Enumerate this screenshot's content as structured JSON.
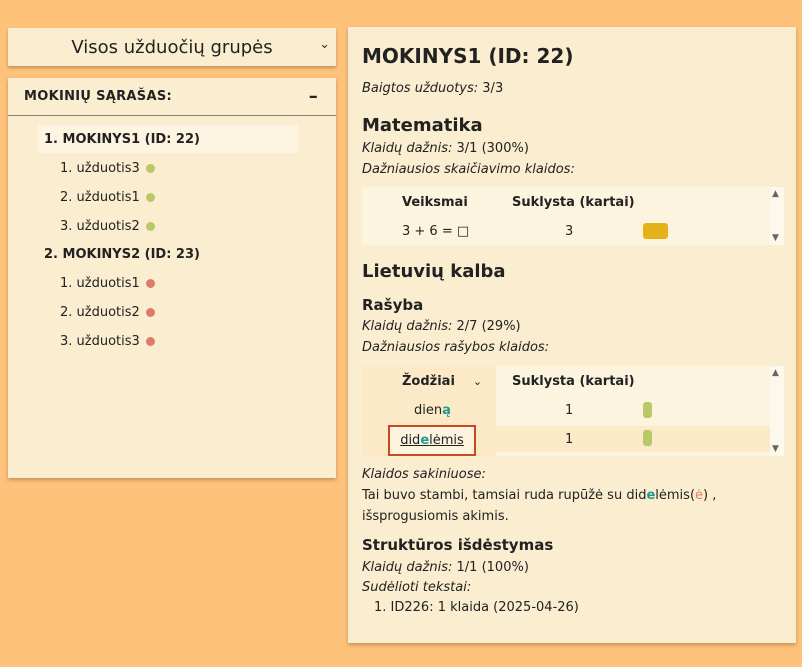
{
  "group_select": {
    "label": "Visos užduočių grupės"
  },
  "students_panel": {
    "title": "MOKINIŲ SĄRAŠAS:",
    "collapse": "–",
    "students": [
      {
        "label": "1. MOKINYS1 (ID: 22)",
        "tasks": [
          {
            "label": "1. užduotis3",
            "status": "green"
          },
          {
            "label": "2. užduotis1",
            "status": "green"
          },
          {
            "label": "3. užduotis2",
            "status": "green"
          }
        ]
      },
      {
        "label": "2. MOKINYS2 (ID: 23)",
        "tasks": [
          {
            "label": "1. užduotis1",
            "status": "red"
          },
          {
            "label": "2. užduotis2",
            "status": "red"
          },
          {
            "label": "3. užduotis3",
            "status": "red"
          }
        ]
      }
    ]
  },
  "detail": {
    "title": "MOKINYS1 (ID: 22)",
    "completed_label": "Baigtos užduotys:",
    "completed_value": " 3/3",
    "math": {
      "heading": "Matematika",
      "rate_label": "Klaidų dažnis:",
      "rate_value": " 3/1 (300%)",
      "common_label": "Dažniausios skaičiavimo klaidos:",
      "col_ops": "Veiksmai",
      "col_count": "Suklysta (kartai)",
      "row_op": "3 + 6 = □",
      "row_count": "3"
    },
    "lt": {
      "heading": "Lietuvių kalba",
      "spelling_heading": "Rašyba",
      "rate_label": "Klaidų dažnis:",
      "rate_value": " 2/7 (29%)",
      "common_label": "Dažniausios rašybos klaidos:",
      "col_words": "Žodžiai",
      "col_count": "Suklysta (kartai)",
      "rows": [
        {
          "prefix": "dien",
          "mark": "ą",
          "suffix": "",
          "count": "1"
        },
        {
          "prefix": "did",
          "mark": "e",
          "suffix": "lėmis",
          "count": "1"
        }
      ],
      "sentences_label": "Klaidos sakiniuose:",
      "sentence_a": "Tai buvo stambi, tamsiai ruda rupūžė su did",
      "sentence_mark": "e",
      "sentence_b": "lėmis(",
      "sentence_correct": "ė",
      "sentence_c": ") ,",
      "sentence_line2": "išsprogusiomis akimis.",
      "structure_heading": "Struktūros išdėstymas",
      "structure_rate_label": "Klaidų dažnis:",
      "structure_rate_value": " 1/1 (100%)",
      "texts_label": "Sudėlioti tekstai:",
      "texts_item": "1. ID226: 1 klaida (2025-04-26)"
    }
  }
}
